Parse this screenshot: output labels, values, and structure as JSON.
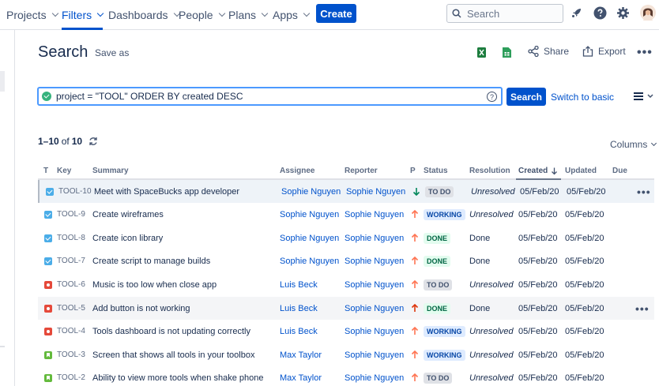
{
  "nav": {
    "items": [
      {
        "label": "Projects"
      },
      {
        "label": "Filters"
      },
      {
        "label": "Dashboards"
      },
      {
        "label": "People"
      },
      {
        "label": "Plans"
      },
      {
        "label": "Apps"
      }
    ],
    "create_label": "Create",
    "search_placeholder": "Search",
    "icons": [
      "rocket-icon",
      "help-icon",
      "settings-icon",
      "avatar"
    ]
  },
  "header": {
    "title": "Search",
    "save_as": "Save as",
    "share": "Share",
    "export": "Export"
  },
  "query": {
    "jql": "project = \"TOOL\" ORDER BY created DESC",
    "help": "?",
    "search_button": "Search",
    "switch_basic": "Switch to basic"
  },
  "results": {
    "range": "1–10",
    "of": "of",
    "total": "10",
    "columns_label": "Columns"
  },
  "table": {
    "headers": {
      "type": "T",
      "key": "Key",
      "summary": "Summary",
      "assignee": "Assignee",
      "reporter": "Reporter",
      "priority": "P",
      "status": "Status",
      "resolution": "Resolution",
      "created": "Created",
      "updated": "Updated",
      "due": "Due"
    },
    "rows": [
      {
        "type": "task",
        "key": "TOOL-10",
        "summary": "Meet with SpaceBucks app developer",
        "assignee": "Sophie Nguyen",
        "reporter": "Sophie Nguyen",
        "priority": "low",
        "status": "TO DO",
        "resolution": "Unresolved",
        "created": "05/Feb/20",
        "updated": "05/Feb/20"
      },
      {
        "type": "task",
        "key": "TOOL-9",
        "summary": "Create wireframes",
        "assignee": "Sophie Nguyen",
        "reporter": "Sophie Nguyen",
        "priority": "medium",
        "status": "WORKING",
        "resolution": "Unresolved",
        "created": "05/Feb/20",
        "updated": "05/Feb/20"
      },
      {
        "type": "task",
        "key": "TOOL-8",
        "summary": "Create icon library",
        "assignee": "Sophie Nguyen",
        "reporter": "Sophie Nguyen",
        "priority": "medium",
        "status": "DONE",
        "resolution": "Done",
        "created": "05/Feb/20",
        "updated": "05/Feb/20"
      },
      {
        "type": "task",
        "key": "TOOL-7",
        "summary": "Create script to manage builds",
        "assignee": "Sophie Nguyen",
        "reporter": "Sophie Nguyen",
        "priority": "medium",
        "status": "DONE",
        "resolution": "Done",
        "created": "05/Feb/20",
        "updated": "05/Feb/20"
      },
      {
        "type": "bug",
        "key": "TOOL-6",
        "summary": "Music is too low when close app",
        "assignee": "Luis Beck",
        "reporter": "Sophie Nguyen",
        "priority": "medium",
        "status": "TO DO",
        "resolution": "Unresolved",
        "created": "05/Feb/20",
        "updated": "05/Feb/20"
      },
      {
        "type": "bug",
        "key": "TOOL-5",
        "summary": "Add button is not working",
        "assignee": "Luis Beck",
        "reporter": "Sophie Nguyen",
        "priority": "high",
        "status": "DONE",
        "resolution": "Done",
        "created": "05/Feb/20",
        "updated": "05/Feb/20"
      },
      {
        "type": "bug",
        "key": "TOOL-4",
        "summary": "Tools dashboard is not updating correctly",
        "assignee": "Luis Beck",
        "reporter": "Sophie Nguyen",
        "priority": "medium",
        "status": "WORKING",
        "resolution": "Unresolved",
        "created": "05/Feb/20",
        "updated": "05/Feb/20"
      },
      {
        "type": "story",
        "key": "TOOL-3",
        "summary": "Screen that shows all tools in your toolbox",
        "assignee": "Max Taylor",
        "reporter": "Sophie Nguyen",
        "priority": "medium",
        "status": "WORKING",
        "resolution": "Unresolved",
        "created": "05/Feb/20",
        "updated": "05/Feb/20"
      },
      {
        "type": "story",
        "key": "TOOL-2",
        "summary": "Ability to view more tools when shake phone",
        "assignee": "Max Taylor",
        "reporter": "Sophie Nguyen",
        "priority": "medium",
        "status": "TO DO",
        "resolution": "Unresolved",
        "created": "05/Feb/20",
        "updated": "05/Feb/20"
      }
    ]
  },
  "colors": {
    "brand": "#0052CC",
    "priority_high": "#DE350B",
    "priority_medium": "#FF7452",
    "priority_low": "#00875A"
  }
}
